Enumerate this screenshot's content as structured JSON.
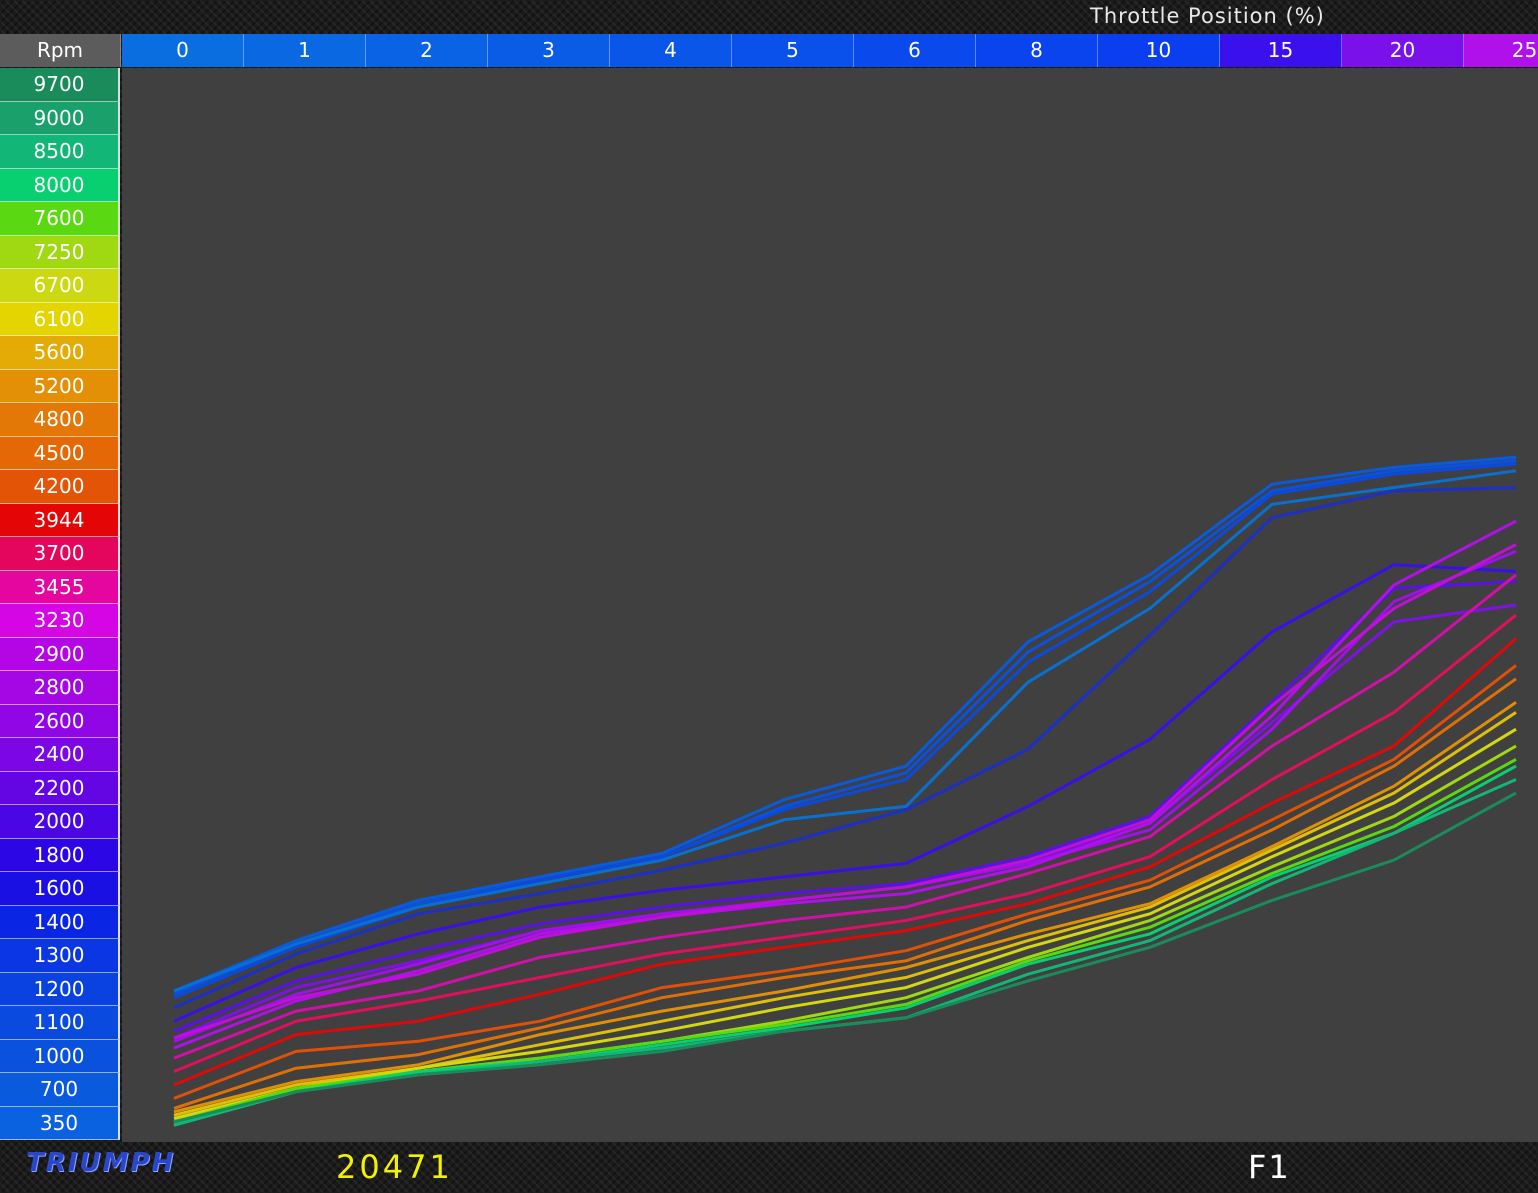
{
  "header": {
    "title": "Throttle Position (%)",
    "corner_label": "Rpm"
  },
  "footer": {
    "logo_text": "TRIUMPH",
    "id": "20471",
    "map": "F1"
  },
  "colors": {
    "plot_bg": "#404040",
    "footer_id": "#f2f200"
  },
  "chart_data": {
    "type": "line",
    "x": [
      "0",
      "1",
      "2",
      "3",
      "4",
      "5",
      "6",
      "8",
      "10",
      "15",
      "20",
      "25"
    ],
    "x_header_colors": [
      "#0a6ee0",
      "#0a68e2",
      "#0a62e4",
      "#0a5ce6",
      "#0a56e8",
      "#0a50ea",
      "#0a4aec",
      "#0a44ee",
      "#0a3eef",
      "#3a10ec",
      "#7a10ea",
      "#b010ea"
    ],
    "rpm_rows": [
      {
        "rpm": "9700",
        "color": "#1a8c5c"
      },
      {
        "rpm": "9000",
        "color": "#1aa06a"
      },
      {
        "rpm": "8500",
        "color": "#12b676"
      },
      {
        "rpm": "8000",
        "color": "#08d070"
      },
      {
        "rpm": "7600",
        "color": "#5ad812"
      },
      {
        "rpm": "7250",
        "color": "#a0d812"
      },
      {
        "rpm": "6700",
        "color": "#ccd812"
      },
      {
        "rpm": "6100",
        "color": "#e4d400"
      },
      {
        "rpm": "5600",
        "color": "#e4aa06"
      },
      {
        "rpm": "5200",
        "color": "#e49006"
      },
      {
        "rpm": "4800",
        "color": "#e47806"
      },
      {
        "rpm": "4500",
        "color": "#e46806"
      },
      {
        "rpm": "4200",
        "color": "#e45406"
      },
      {
        "rpm": "3944",
        "color": "#e40606"
      },
      {
        "rpm": "3700",
        "color": "#e4065c"
      },
      {
        "rpm": "3455",
        "color": "#e4069e"
      },
      {
        "rpm": "3230",
        "color": "#d406e4"
      },
      {
        "rpm": "2900",
        "color": "#b406e4"
      },
      {
        "rpm": "2800",
        "color": "#a406e4"
      },
      {
        "rpm": "2600",
        "color": "#9006e4"
      },
      {
        "rpm": "2400",
        "color": "#7c06e4"
      },
      {
        "rpm": "2200",
        "color": "#6406e4"
      },
      {
        "rpm": "2000",
        "color": "#4a06e4"
      },
      {
        "rpm": "1800",
        "color": "#2c06e4"
      },
      {
        "rpm": "1600",
        "color": "#1a10e4"
      },
      {
        "rpm": "1400",
        "color": "#0a26e4"
      },
      {
        "rpm": "1300",
        "color": "#0a36e4"
      },
      {
        "rpm": "1200",
        "color": "#0a42e0"
      },
      {
        "rpm": "1100",
        "color": "#0a4ade"
      },
      {
        "rpm": "1000",
        "color": "#0a52de"
      },
      {
        "rpm": "700",
        "color": "#0a5ade"
      },
      {
        "rpm": "350",
        "color": "#0a62e0"
      }
    ],
    "ylim": [
      0,
      32
    ],
    "series": [
      {
        "color": "#0a5ade",
        "values": [
          4.5,
          6.0,
          7.2,
          7.9,
          8.6,
          10.2,
          11.2,
          14.9,
          16.9,
          19.6,
          20.1,
          20.4
        ]
      },
      {
        "color": "#0a52de",
        "values": [
          4.4,
          5.9,
          7.1,
          7.8,
          8.5,
          10.0,
          11.0,
          14.6,
          16.7,
          19.4,
          20.0,
          20.3
        ]
      },
      {
        "color": "#0a4ade",
        "values": [
          4.3,
          5.8,
          7.0,
          7.8,
          8.5,
          9.9,
          10.8,
          14.3,
          16.4,
          19.3,
          19.9,
          20.2
        ]
      },
      {
        "color": "#0a70d0",
        "values": [
          4.5,
          5.9,
          7.0,
          7.7,
          8.4,
          9.6,
          10.0,
          13.7,
          15.9,
          19.0,
          19.5,
          20.0
        ]
      },
      {
        "color": "#1a30c8",
        "values": [
          4.0,
          5.6,
          6.8,
          7.4,
          8.1,
          8.9,
          9.9,
          11.7,
          15.1,
          18.6,
          19.4,
          19.5
        ]
      },
      {
        "color": "#3a10ea",
        "values": [
          3.6,
          5.2,
          6.2,
          7.0,
          7.5,
          7.9,
          8.3,
          10.0,
          12.0,
          15.2,
          17.2,
          17.0
        ]
      },
      {
        "color": "#5a10e8",
        "values": [
          3.3,
          4.8,
          5.7,
          6.5,
          7.0,
          7.4,
          7.7,
          8.5,
          9.7,
          13.1,
          16.5,
          16.7
        ]
      },
      {
        "color": "#8010e8",
        "values": [
          3.1,
          4.6,
          5.4,
          6.3,
          6.8,
          7.2,
          7.6,
          8.3,
          9.5,
          12.5,
          15.5,
          16.0
        ]
      },
      {
        "color": "#a010ea",
        "values": [
          3.0,
          4.4,
          5.3,
          6.3,
          6.8,
          7.2,
          7.6,
          8.3,
          9.3,
          12.3,
          16.1,
          17.6
        ]
      },
      {
        "color": "#b010ea",
        "values": [
          2.8,
          4.2,
          5.1,
          6.2,
          6.7,
          7.1,
          7.4,
          8.2,
          9.5,
          12.7,
          16.6,
          18.5
        ]
      },
      {
        "color": "#c010d8",
        "values": [
          3.1,
          4.3,
          5.0,
          6.1,
          6.7,
          7.2,
          7.6,
          8.4,
          9.6,
          13.0,
          15.9,
          17.8
        ]
      },
      {
        "color": "#d010a8",
        "values": [
          2.5,
          3.9,
          4.5,
          5.5,
          6.1,
          6.6,
          7.0,
          8.0,
          9.1,
          11.8,
          14.0,
          16.9
        ]
      },
      {
        "color": "#e0105c",
        "values": [
          2.1,
          3.6,
          4.2,
          4.9,
          5.6,
          6.1,
          6.6,
          7.4,
          8.5,
          10.8,
          12.8,
          15.7
        ]
      },
      {
        "color": "#e00808",
        "values": [
          1.7,
          3.2,
          3.6,
          4.4,
          5.3,
          5.8,
          6.3,
          7.1,
          8.2,
          10.1,
          11.8,
          15.0
        ]
      },
      {
        "color": "#e05006",
        "values": [
          1.3,
          2.7,
          3.0,
          3.6,
          4.6,
          5.1,
          5.7,
          6.8,
          7.8,
          9.6,
          11.4,
          14.2
        ]
      },
      {
        "color": "#e07006",
        "values": [
          1.0,
          2.2,
          2.6,
          3.4,
          4.3,
          4.9,
          5.4,
          6.6,
          7.6,
          9.3,
          11.2,
          13.8
        ]
      },
      {
        "color": "#e09006",
        "values": [
          0.9,
          1.8,
          2.3,
          3.2,
          3.9,
          4.5,
          5.2,
          6.2,
          7.1,
          8.8,
          10.6,
          13.1
        ]
      },
      {
        "color": "#e0c006",
        "values": [
          0.8,
          1.7,
          2.2,
          2.9,
          3.6,
          4.3,
          4.9,
          6.0,
          7.0,
          8.7,
          10.4,
          12.8
        ]
      },
      {
        "color": "#d4d810",
        "values": [
          0.7,
          1.6,
          2.2,
          2.7,
          3.3,
          4.0,
          4.6,
          5.8,
          6.8,
          8.5,
          10.1,
          12.3
        ]
      },
      {
        "color": "#a0d812",
        "values": [
          0.6,
          1.6,
          2.1,
          2.5,
          3.0,
          3.6,
          4.3,
          5.5,
          6.6,
          8.2,
          9.7,
          11.8
        ]
      },
      {
        "color": "#5ad812",
        "values": [
          0.6,
          1.6,
          2.1,
          2.5,
          3.0,
          3.5,
          4.1,
          5.4,
          6.4,
          8.0,
          9.4,
          11.4
        ]
      },
      {
        "color": "#08d070",
        "values": [
          0.5,
          1.5,
          2.1,
          2.4,
          2.9,
          3.4,
          4.0,
          5.3,
          6.2,
          7.9,
          9.2,
          11.2
        ]
      },
      {
        "color": "#12b676",
        "values": [
          0.5,
          1.5,
          2.0,
          2.4,
          2.8,
          3.3,
          3.7,
          5.0,
          6.0,
          7.7,
          9.2,
          10.8
        ]
      },
      {
        "color": "#1a8c5c",
        "values": [
          0.6,
          1.5,
          2.0,
          2.3,
          2.7,
          3.3,
          3.7,
          4.8,
          5.8,
          7.2,
          8.4,
          10.4
        ]
      }
    ]
  }
}
